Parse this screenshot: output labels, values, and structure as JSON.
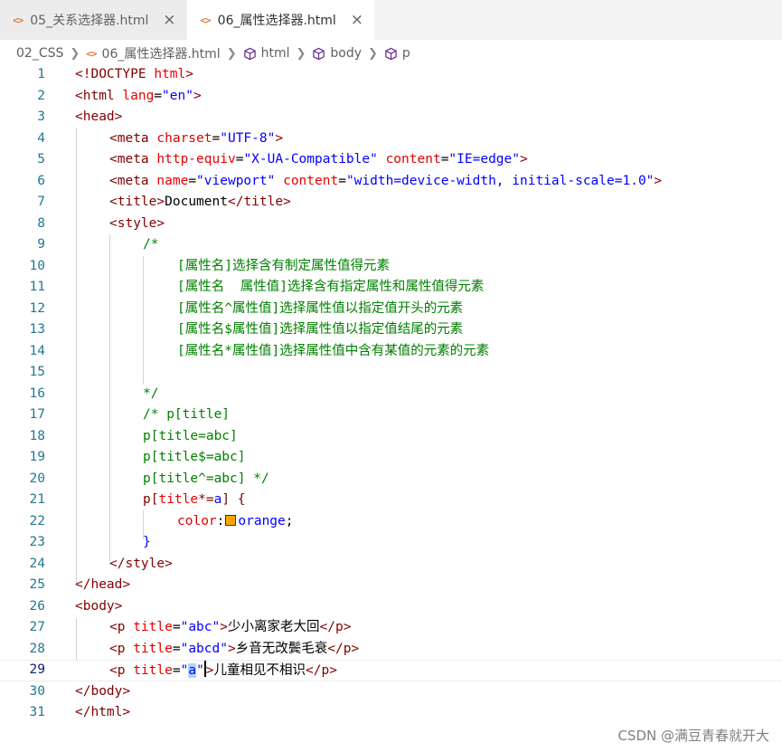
{
  "tabs": [
    {
      "label": "05_关系选择器.html",
      "icon": "html-file-icon",
      "active": false,
      "close": "×"
    },
    {
      "label": "06_属性选择器.html",
      "icon": "html-file-icon",
      "active": true,
      "close": "×"
    }
  ],
  "file_icon_glyph": "<>",
  "breadcrumb": [
    "02_CSS",
    "06_属性选择器.html",
    "html",
    "body",
    "p"
  ],
  "editor": {
    "current_line": 29,
    "lines": [
      {
        "n": "1"
      },
      {
        "n": "2"
      },
      {
        "n": "3"
      },
      {
        "n": "4"
      },
      {
        "n": "5"
      },
      {
        "n": "6"
      },
      {
        "n": "7"
      },
      {
        "n": "8"
      },
      {
        "n": "9"
      },
      {
        "n": "10"
      },
      {
        "n": "11"
      },
      {
        "n": "12"
      },
      {
        "n": "13"
      },
      {
        "n": "14"
      },
      {
        "n": "15"
      },
      {
        "n": "16"
      },
      {
        "n": "17"
      },
      {
        "n": "18"
      },
      {
        "n": "19"
      },
      {
        "n": "20"
      },
      {
        "n": "21"
      },
      {
        "n": "22"
      },
      {
        "n": "23"
      },
      {
        "n": "24"
      },
      {
        "n": "25"
      },
      {
        "n": "26"
      },
      {
        "n": "27"
      },
      {
        "n": "28"
      },
      {
        "n": "29"
      },
      {
        "n": "30"
      },
      {
        "n": "31"
      }
    ],
    "code": {
      "l1": [
        "<!DOCTYPE ",
        "html",
        ">"
      ],
      "l2": [
        "<",
        "html",
        " ",
        "lang",
        "=",
        "\"en\"",
        ">"
      ],
      "l3": [
        "<",
        "head",
        ">"
      ],
      "l4": [
        "<",
        "meta",
        " ",
        "charset",
        "=",
        "\"UTF-8\"",
        ">"
      ],
      "l5": [
        "<",
        "meta",
        " ",
        "http-equiv",
        "=",
        "\"X-UA-Compatible\"",
        " ",
        "content",
        "=",
        "\"IE=edge\"",
        ">"
      ],
      "l6": [
        "<",
        "meta",
        " ",
        "name",
        "=",
        "\"viewport\"",
        " ",
        "content",
        "=",
        "\"width=device-width, initial-scale=1.0\"",
        ">"
      ],
      "l7": [
        "<",
        "title",
        ">",
        "Document",
        "</",
        "title",
        ">"
      ],
      "l8": [
        "<",
        "style",
        ">"
      ],
      "l9": "/*",
      "l10": "[属性名]选择含有制定属性值得元素",
      "l11": "[属性名  属性值]选择含有指定属性和属性值得元素",
      "l12": "[属性名^属性值]选择属性值以指定值开头的元素",
      "l13": "[属性名$属性值]选择属性值以指定值结尾的元素",
      "l14": "[属性名*属性值]选择属性值中含有某值的元素的元素",
      "l15": "",
      "l16": "*/",
      "l17": "/* p[title]",
      "l18": "p[title=abc]",
      "l19": "p[title$=abc]",
      "l20": "p[title^=abc] */",
      "l21": [
        "p[",
        "title",
        "*=",
        "a",
        "] {"
      ],
      "l22": [
        "color",
        ":",
        "orange",
        ";"
      ],
      "l23": "}",
      "l24": [
        "</",
        "style",
        ">"
      ],
      "l25": [
        "</",
        "head",
        ">"
      ],
      "l26": [
        "<",
        "body",
        ">"
      ],
      "l27": [
        "<",
        "p",
        " ",
        "title",
        "=",
        "\"abc\"",
        ">",
        "少小离家老大回",
        "</",
        "p",
        ">"
      ],
      "l28": [
        "<",
        "p",
        " ",
        "title",
        "=",
        "\"abcd\"",
        ">",
        "乡音无改鬓毛衰",
        "</",
        "p",
        ">"
      ],
      "l29": [
        "<",
        "p",
        " ",
        "title",
        "=",
        "\"",
        "a",
        "\"",
        ">",
        "儿童相见不相识",
        "</",
        "p",
        ">"
      ],
      "l30": [
        "</",
        "body",
        ">"
      ],
      "l31": [
        "</",
        "html",
        ">"
      ]
    }
  },
  "colors": {
    "tag": "#800000",
    "attr": "#e50000",
    "string": "#0000ff",
    "comment": "#008000",
    "line_number": "#237893",
    "swatch": "#ffa500"
  },
  "watermark": "CSDN @满豆青春就开大"
}
